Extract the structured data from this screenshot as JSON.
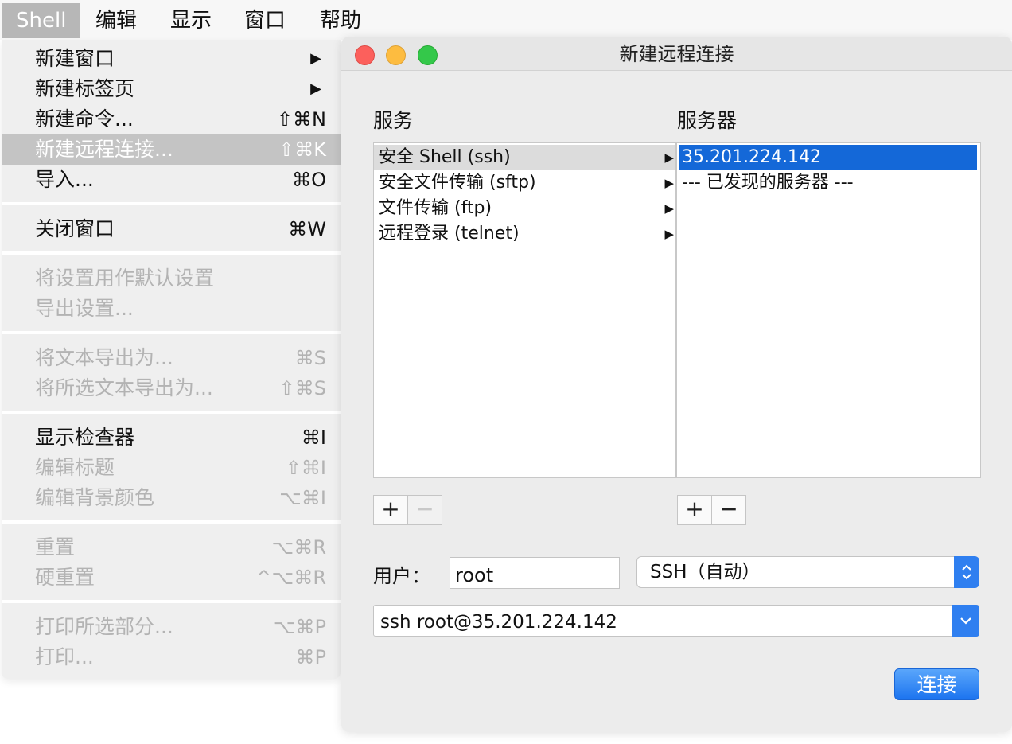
{
  "menubar": {
    "items": [
      {
        "label": "Shell"
      },
      {
        "label": "编辑"
      },
      {
        "label": "显示"
      },
      {
        "label": "窗口"
      },
      {
        "label": "帮助"
      }
    ]
  },
  "shell_menu": {
    "items": [
      {
        "label": "新建窗口",
        "shortcut": "▶"
      },
      {
        "label": "新建标签页",
        "shortcut": "▶"
      },
      {
        "label": "新建命令...",
        "shortcut": "⇧⌘N"
      },
      {
        "label": "新建远程连接...",
        "shortcut": "⇧⌘K"
      },
      {
        "label": "导入...",
        "shortcut": "⌘O"
      },
      {
        "label": "关闭窗口",
        "shortcut": "⌘W"
      },
      {
        "label": "将设置用作默认设置",
        "shortcut": ""
      },
      {
        "label": "导出设置...",
        "shortcut": ""
      },
      {
        "label": "将文本导出为...",
        "shortcut": "⌘S"
      },
      {
        "label": "将所选文本导出为...",
        "shortcut": "⇧⌘S"
      },
      {
        "label": "显示检查器",
        "shortcut": "⌘I"
      },
      {
        "label": "编辑标题",
        "shortcut": "⇧⌘I"
      },
      {
        "label": "编辑背景颜色",
        "shortcut": "⌥⌘I"
      },
      {
        "label": "重置",
        "shortcut": "⌥⌘R"
      },
      {
        "label": "硬重置",
        "shortcut": "^⌥⌘R"
      },
      {
        "label": "打印所选部分...",
        "shortcut": "⌥⌘P"
      },
      {
        "label": "打印...",
        "shortcut": "⌘P"
      }
    ]
  },
  "dialog": {
    "title": "新建远程连接",
    "services_header": "服务",
    "servers_header": "服务器",
    "services": [
      {
        "label": "安全 Shell (ssh)"
      },
      {
        "label": "安全文件传输 (sftp)"
      },
      {
        "label": "文件传输 (ftp)"
      },
      {
        "label": "远程登录 (telnet)"
      }
    ],
    "servers": [
      {
        "label": "35.201.224.142"
      },
      {
        "label": "--- 已发现的服务器 ---"
      }
    ],
    "plus": "+",
    "minus": "−",
    "user_label": "用户：",
    "user_value": "root",
    "protocol_value": "SSH（自动）",
    "command_value": "ssh root@35.201.224.142",
    "connect_label": "连接"
  },
  "colors": {
    "accent": "#1468d8",
    "button_blue": "#2f7ff0",
    "disabled_text": "#b3b3b3"
  }
}
